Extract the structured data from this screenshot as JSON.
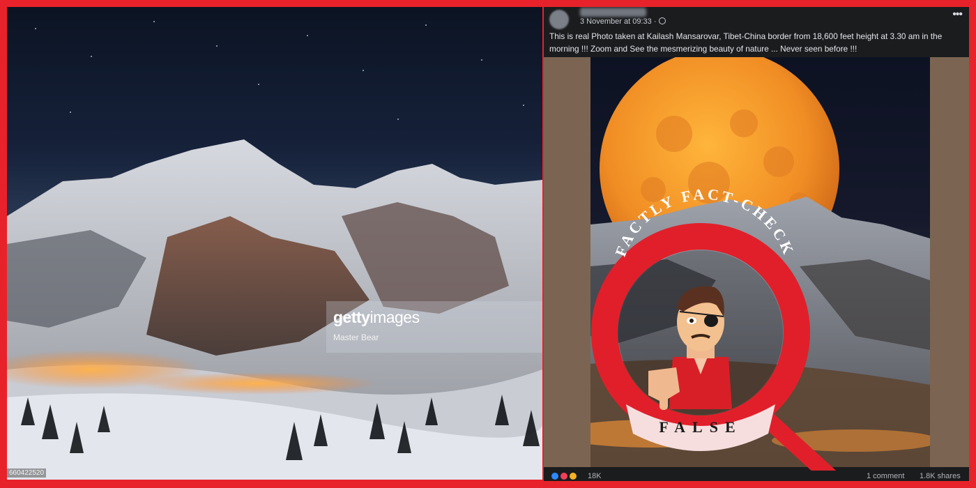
{
  "left_image": {
    "watermark_brand": "gettyimages",
    "watermark_brand_bold": "getty",
    "watermark_brand_rest": "images",
    "watermark_credit": "Master Bear",
    "image_id": "660422520"
  },
  "post": {
    "timestamp": "3 November at 09:33 ·",
    "caption": "This is real Photo taken at Kailash Mansarovar, Tibet-China border from 18,600 feet height at 3.30 am in the morning !!!  Zoom and See the mesmerizing beauty of nature ...  Never seen before !!!",
    "reaction_count": "18K",
    "comments": "1 comment",
    "shares": "1.8K shares"
  },
  "stamp": {
    "arc_text": "FACTLY FACT-CHECK",
    "verdict": "FALSE"
  },
  "colors": {
    "frame_red": "#e8222a",
    "stamp_red": "#e11f2a",
    "verdict_banner": "#f6dede",
    "moon_orange": "#f59a2a",
    "post_bg": "#1b1c1e"
  }
}
